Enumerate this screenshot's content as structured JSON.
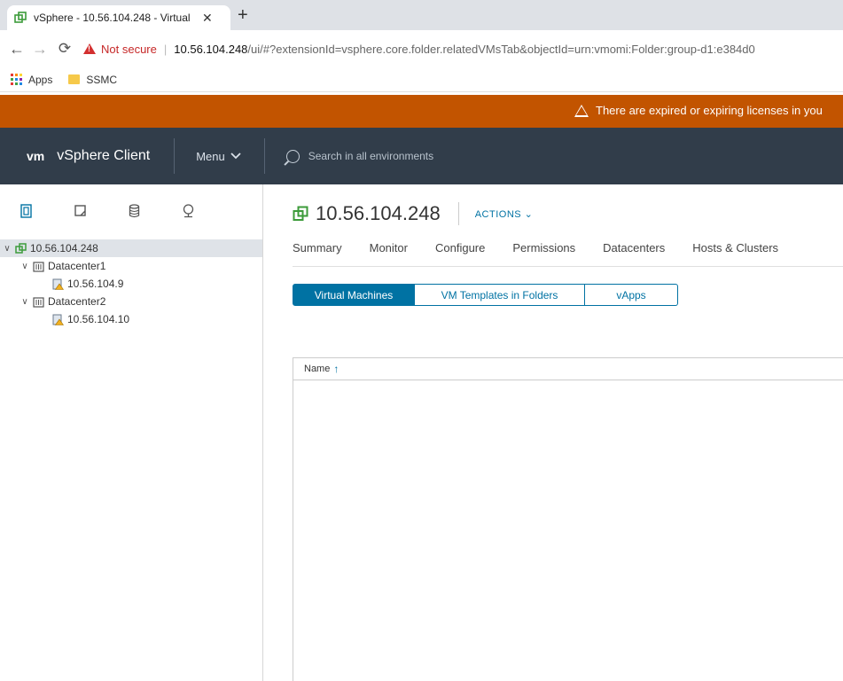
{
  "browser": {
    "tab_title": "vSphere - 10.56.104.248 - Virtual",
    "tab_close": "✕",
    "new_tab": "+",
    "not_secure": "Not secure",
    "url_host": "10.56.104.248",
    "url_rest": "/ui/#?extensionId=vsphere.core.folder.relatedVMsTab&objectId=urn:vmomi:Folder:group-d1:e384d0",
    "bookmarks": [
      "Apps",
      "SSMC"
    ]
  },
  "banner": {
    "text": "There are expired or expiring licenses in you"
  },
  "header": {
    "logo": "vm",
    "title": "vSphere Client",
    "menu_label": "Menu",
    "search_placeholder": "Search in all environments"
  },
  "tree": [
    {
      "label": "10.56.104.248",
      "level": 0,
      "type": "vcenter",
      "expanded": true,
      "selected": true
    },
    {
      "label": "Datacenter1",
      "level": 1,
      "type": "datacenter",
      "expanded": true
    },
    {
      "label": "10.56.104.9",
      "level": 2,
      "type": "host-warning"
    },
    {
      "label": "Datacenter2",
      "level": 1,
      "type": "datacenter",
      "expanded": true
    },
    {
      "label": "10.56.104.10",
      "level": 2,
      "type": "host-warning"
    }
  ],
  "main": {
    "object_title": "10.56.104.248",
    "actions_label": "ACTIONS",
    "tabs": [
      "Summary",
      "Monitor",
      "Configure",
      "Permissions",
      "Datacenters",
      "Hosts & Clusters"
    ],
    "segments": [
      "Virtual Machines",
      "VM Templates in Folders",
      "vApps"
    ],
    "grid_column": "Name"
  },
  "colors": {
    "banner": "#c25400",
    "header": "#313d4a",
    "accent": "#0072a3",
    "vcenter_icon": "#3c9b3a"
  }
}
